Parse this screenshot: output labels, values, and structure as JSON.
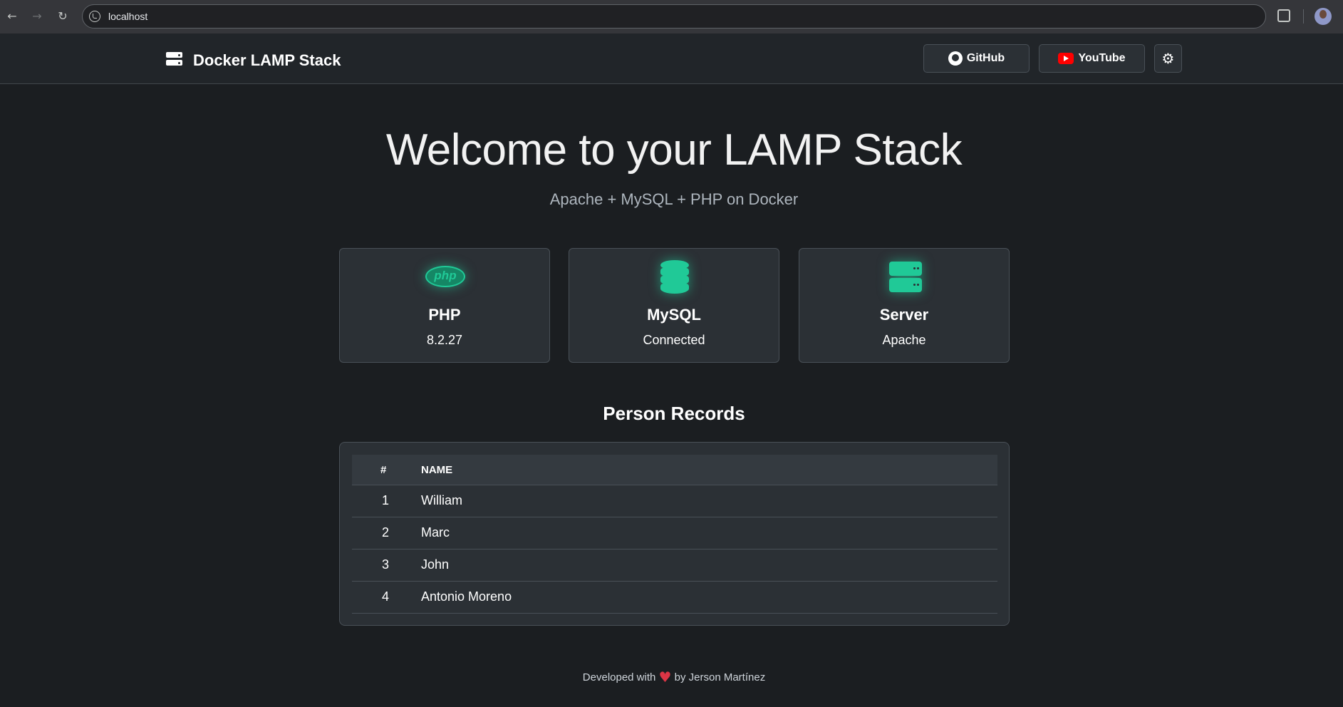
{
  "browser": {
    "url": "localhost",
    "icons": [
      "arrow-left-icon",
      "arrow-right-icon",
      "reload-icon",
      "site-info-icon",
      "extensions-icon",
      "profile-avatar"
    ]
  },
  "navbar": {
    "brand": "Docker LAMP Stack",
    "brand_icon": "server-icon",
    "github_label": "GitHub",
    "youtube_label": "YouTube",
    "theme_icon": "gear-icon"
  },
  "hero": {
    "title": "Welcome to your LAMP Stack",
    "subtitle": "Apache + MySQL + PHP on Docker"
  },
  "cards": [
    {
      "icon": "php-icon",
      "title": "PHP",
      "value": "8.2.27"
    },
    {
      "icon": "database-icon",
      "title": "MySQL",
      "value": "Connected"
    },
    {
      "icon": "server-icon",
      "title": "Server",
      "value": "Apache"
    }
  ],
  "records": {
    "title": "Person Records",
    "columns": [
      "#",
      "NAME"
    ],
    "rows": [
      {
        "id": "1",
        "name": "William"
      },
      {
        "id": "2",
        "name": "Marc"
      },
      {
        "id": "3",
        "name": "John"
      },
      {
        "id": "4",
        "name": "Antonio Moreno"
      }
    ]
  },
  "footer": {
    "prefix": "Developed with",
    "suffix": "by Jerson Martínez",
    "heart_icon": "heart-icon"
  },
  "colors": {
    "accent": "#20c997",
    "background": "#1b1e21",
    "card": "#2b3035",
    "youtube": "#ff0000",
    "heart": "#dc3545"
  }
}
